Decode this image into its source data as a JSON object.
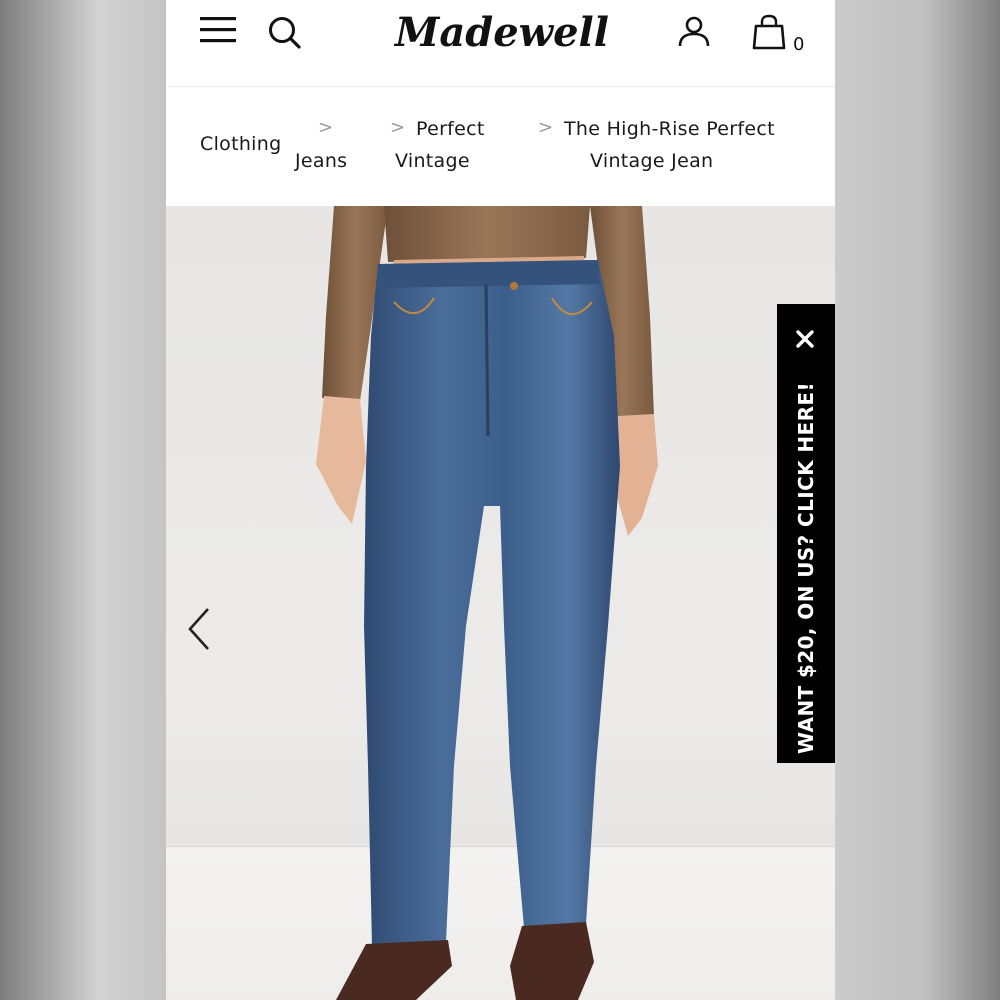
{
  "header": {
    "brand": "Madewell",
    "bag_count": "0",
    "icons": [
      "menu-icon",
      "search-icon",
      "account-icon",
      "bag-icon"
    ]
  },
  "breadcrumb": {
    "items": [
      {
        "line1": "Clothing",
        "line2": ""
      },
      {
        "line1": "",
        "line2": "Jeans"
      },
      {
        "line1": "Perfect",
        "line2": "Vintage"
      },
      {
        "line1": "The High-Rise Perfect",
        "line2": "Vintage Jean"
      }
    ]
  },
  "gallery": {
    "nav_icon": "chevron-left-icon"
  },
  "promo": {
    "text": "WANT $20, ON US? CLICK HERE!",
    "close_icon": "close-icon"
  },
  "colors": {
    "promo_bg": "#000000",
    "denim": "#3e5f8c",
    "sweater": "#8c6a50"
  }
}
